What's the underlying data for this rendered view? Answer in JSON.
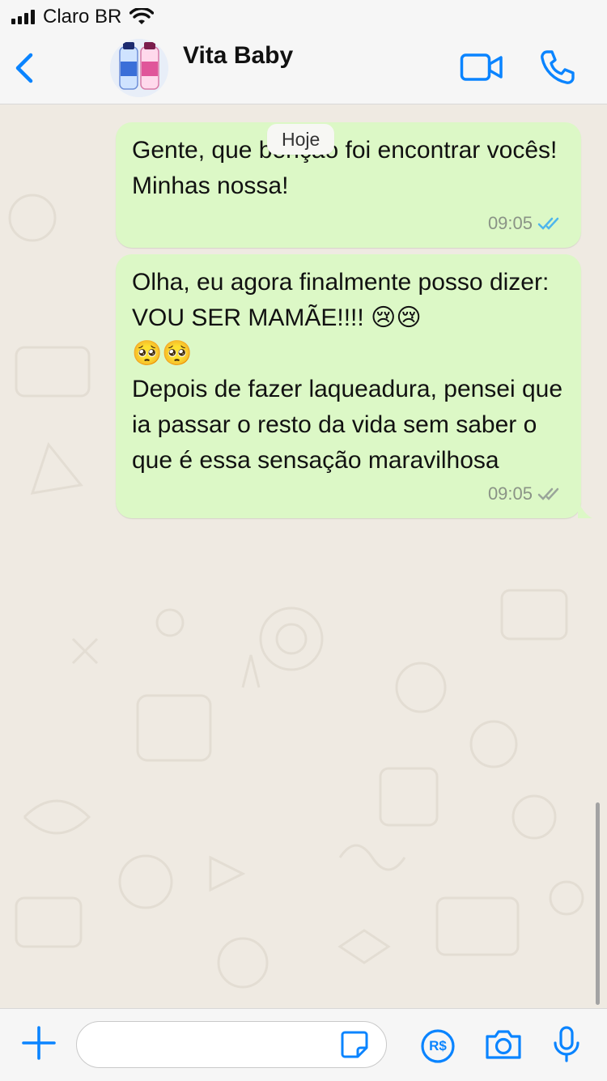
{
  "status_bar": {
    "carrier": "Claro BR"
  },
  "header": {
    "contact_name": "Vita Baby",
    "icons": [
      "back-chevron-icon",
      "avatar",
      "video-call-icon",
      "phone-icon"
    ]
  },
  "chat": {
    "date_chip": "Hoje",
    "messages": [
      {
        "text": "Gente, que benção foi encontrar vocês!\nMinhas nossa!",
        "time": "09:05",
        "status": "read"
      },
      {
        "text": "Olha, eu agora finalmente posso dizer: VOU SER MAMÃE!!!! 😢😢\n🥺🥺\nDepois de fazer laqueadura, pensei que ia passar o resto da vida sem saber o que é essa sensação maravilhosa",
        "time": "09:05",
        "status": "delivered"
      }
    ]
  },
  "composer": {
    "input_value": "",
    "icons": [
      "plus-icon",
      "sticker-icon",
      "payment-icon",
      "camera-icon",
      "microphone-icon"
    ],
    "payment_label": "R$"
  },
  "colors": {
    "accent": "#0a84ff",
    "bubble_out": "#dcf8c6",
    "read_ticks": "#4fb6ec",
    "delivered_ticks": "#9aa59a",
    "chat_bg": "#efeae2"
  }
}
